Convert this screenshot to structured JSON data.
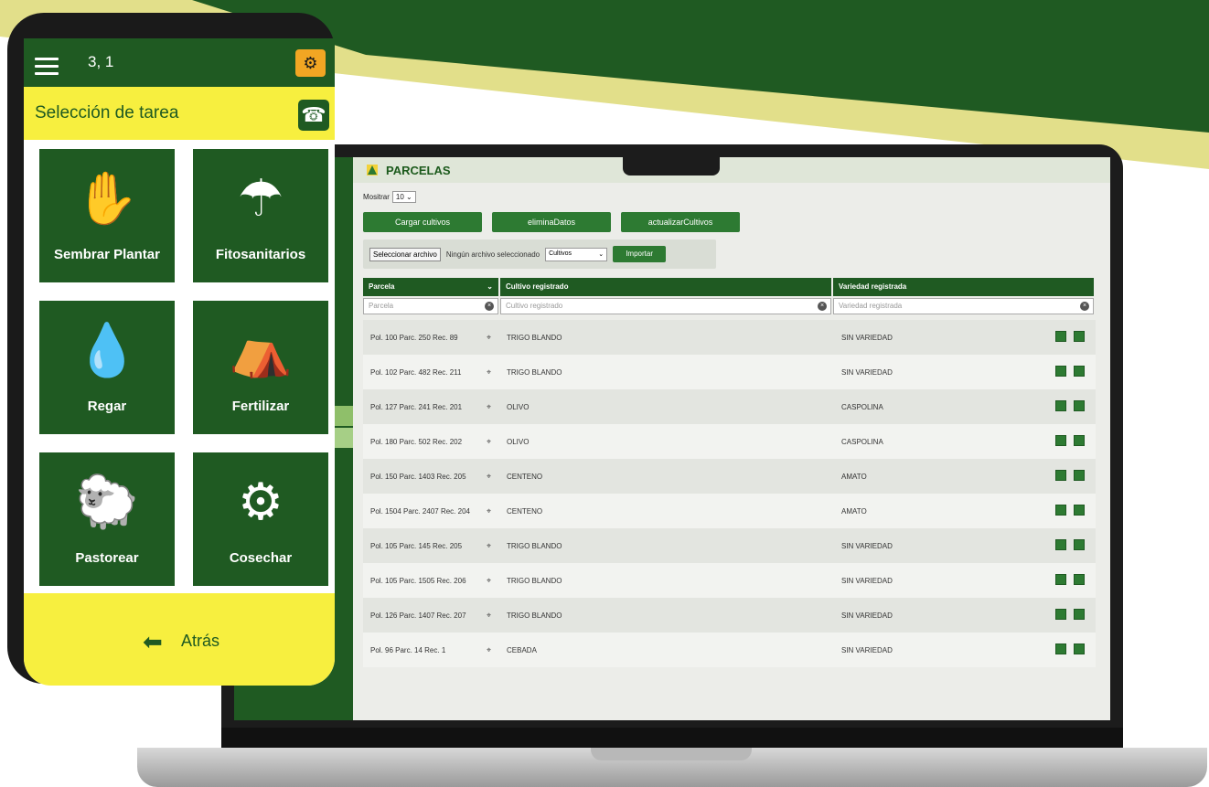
{
  "colors": {
    "dark_green": "#1f5a22",
    "mid_green": "#2d7a32",
    "yellow": "#f7ef3f",
    "light_yellow": "#e2df8a",
    "orange": "#f2a623"
  },
  "phone": {
    "coords": "3, 1",
    "task_title": "Selección de tarea",
    "tiles": [
      {
        "label": "Sembrar Plantar",
        "icon": "sowing-hand-icon"
      },
      {
        "label": "Fitosanitarios",
        "icon": "sprayer-icon"
      },
      {
        "label": "Regar",
        "icon": "irrigation-icon"
      },
      {
        "label": "Fertilizar",
        "icon": "fertilizer-bag-icon"
      },
      {
        "label": "Pastorear",
        "icon": "grazing-icon"
      },
      {
        "label": "Cosechar",
        "icon": "harvester-icon"
      }
    ],
    "back_label": "Atrás"
  },
  "app": {
    "title": "PARCELAS",
    "show_label": "Mositrar",
    "show_value": "10",
    "buttons": [
      "Cargar cultivos",
      "eliminaDatos",
      "actualizarCultivos"
    ],
    "file_button": "Seleccionar archivo",
    "no_file": "Ningún archivo seleccionado",
    "crop_select": "Cultivos",
    "import_button": "Importar",
    "columns": [
      "Parcela",
      "Cultivo registrado",
      "Variedad registrada"
    ],
    "filters": [
      "Parcela",
      "Cultivo registrado",
      "Variedad registrada"
    ],
    "rows": [
      {
        "parcela": "Pol. 100 Parc. 250 Rec. 89",
        "cultivo": "TRIGO BLANDO",
        "variedad": "SIN VARIEDAD"
      },
      {
        "parcela": "Pol. 102 Parc. 482 Rec. 211",
        "cultivo": "TRIGO BLANDO",
        "variedad": "SIN VARIEDAD"
      },
      {
        "parcela": "Pol. 127 Parc. 241 Rec. 201",
        "cultivo": "OLIVO",
        "variedad": "CASPOLINA"
      },
      {
        "parcela": "Pol. 180 Parc. 502 Rec. 202",
        "cultivo": "OLIVO",
        "variedad": "CASPOLINA"
      },
      {
        "parcela": "Pol. 150 Parc. 1403 Rec. 205",
        "cultivo": "CENTENO",
        "variedad": "AMATO"
      },
      {
        "parcela": "Pol. 1504 Parc. 2407 Rec. 204",
        "cultivo": "CENTENO",
        "variedad": "AMATO"
      },
      {
        "parcela": "Pol. 105 Parc. 145 Rec. 205",
        "cultivo": "TRIGO BLANDO",
        "variedad": "SIN VARIEDAD"
      },
      {
        "parcela": "Pol. 105 Parc. 1505 Rec. 206",
        "cultivo": "TRIGO BLANDO",
        "variedad": "SIN VARIEDAD"
      },
      {
        "parcela": "Pol. 126 Parc. 1407 Rec. 207",
        "cultivo": "TRIGO BLANDO",
        "variedad": "SIN VARIEDAD"
      },
      {
        "parcela": "Pol. 96 Parc. 14 Rec. 1",
        "cultivo": "CEBADA",
        "variedad": "SIN VARIEDAD"
      }
    ]
  }
}
